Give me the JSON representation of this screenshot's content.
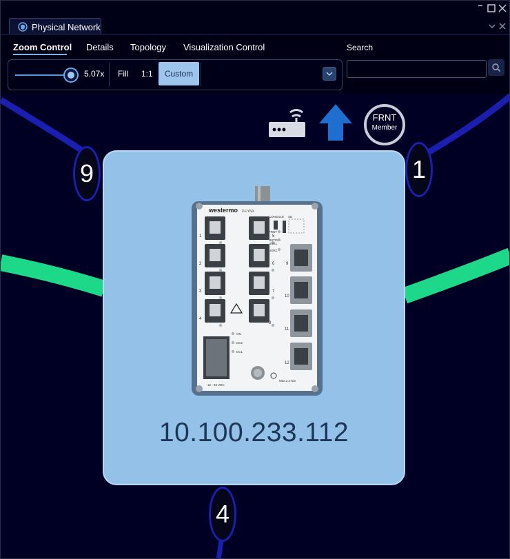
{
  "window": {
    "tab_title": "Physical Network",
    "controls": {
      "minimize": "‾",
      "maximize": "☐",
      "close": "✕",
      "tab_dropdown": "⌄",
      "tab_close": "✕"
    }
  },
  "menu": {
    "items": [
      {
        "label": "Zoom Control",
        "active": true
      },
      {
        "label": "Details",
        "active": false
      },
      {
        "label": "Topology",
        "active": false
      },
      {
        "label": "Visualization Control",
        "active": false
      }
    ]
  },
  "zoom": {
    "level": 5.07,
    "value_label": "5.07x",
    "fill_label": "Fill",
    "one_to_one_label": "1:1",
    "custom_label": "Custom"
  },
  "search": {
    "label": "Search",
    "value": "",
    "placeholder": ""
  },
  "node": {
    "ip": "10.100.233.112",
    "frnt_label": "FRNT",
    "member_label": "Member",
    "port_badges": [
      {
        "label": "9"
      },
      {
        "label": "1"
      },
      {
        "label": "4"
      }
    ],
    "device": {
      "brand": "westermo",
      "model": "D-LYNX",
      "console_label": "CONSOLE",
      "sd_label": "SD",
      "frnt_led": "FRNT",
      "rstp_led": "RSTP/",
      "usr1_led": "USR1",
      "usr2_led": "USR2",
      "on_led": "ON",
      "dc2_led": "DC2",
      "dc1_led": "DC1",
      "port_numbers": [
        "1",
        "2",
        "3",
        "4",
        "5",
        "6",
        "7",
        "8",
        "9",
        "10",
        "11",
        "12"
      ],
      "power_label": "12 - 48 VDC",
      "torque_label": "Max 2,2 Nm"
    }
  },
  "colors": {
    "background": "#000025",
    "link_blue": "#1a1fb0",
    "link_green": "#1ed88a",
    "card": "#93c1e8",
    "up_arrow": "#1e6fd0",
    "accent": "#9ec6ec"
  },
  "icons": [
    "shield-icon",
    "router-icon",
    "up-arrow-icon",
    "search-icon",
    "chevron-down-icon"
  ]
}
